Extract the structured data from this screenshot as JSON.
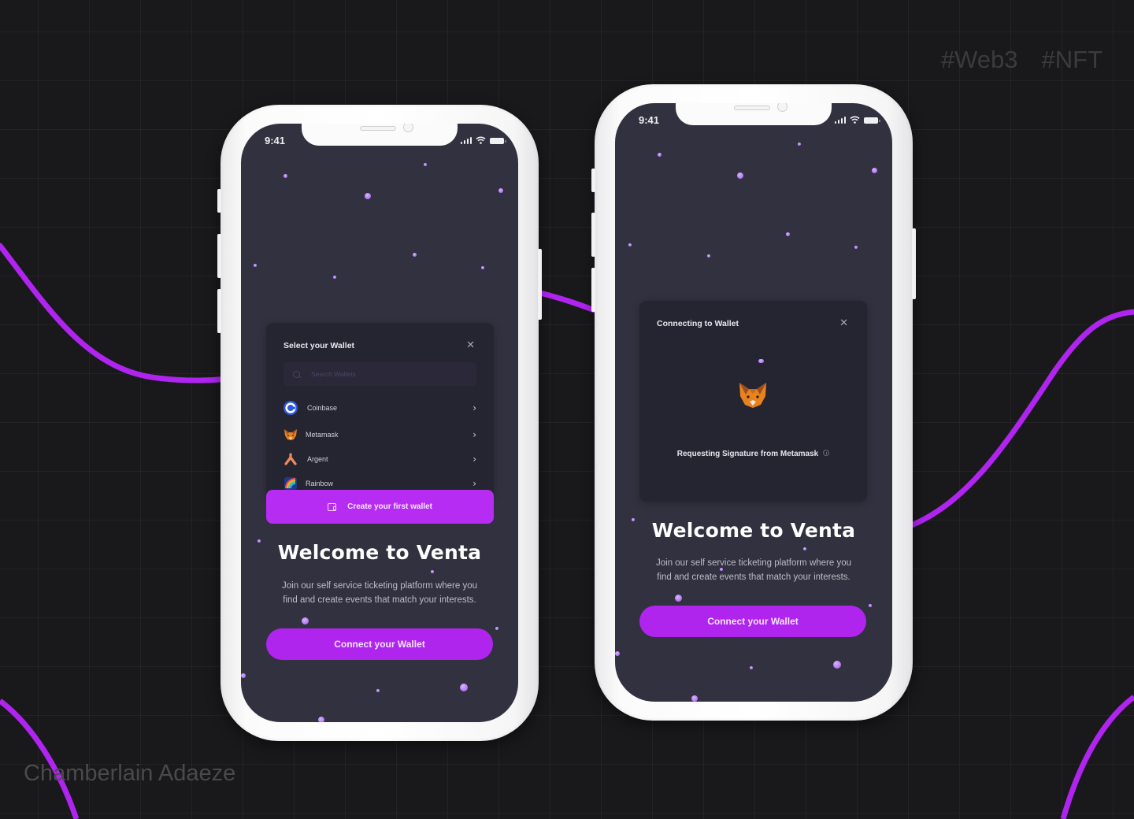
{
  "background": {
    "color": "#19181a",
    "accent_curve_color": "#b024f0",
    "tags": [
      "#Web3",
      "#NFT"
    ],
    "credit": "Chamberlain Adaeze"
  },
  "colors": {
    "primary": "#b025ee",
    "screen_bg": "#32313f",
    "modal_bg": "#252431"
  },
  "phone_left": {
    "status": {
      "time": "9:41",
      "icons": [
        "signal-icon",
        "wifi-icon",
        "battery-icon"
      ]
    },
    "modal": {
      "title": "Select your Wallet",
      "close_icon": "close-icon",
      "search": {
        "placeholder": "Search Wallets",
        "value": "",
        "icon": "search-icon"
      },
      "wallets": [
        {
          "name": "Coinbase",
          "icon": "coinbase-icon"
        },
        {
          "name": "Metamask",
          "icon": "metamask-fox-icon"
        },
        {
          "name": "Argent",
          "icon": "argent-icon"
        },
        {
          "name": "Rainbow",
          "icon": "rainbow-icon"
        }
      ],
      "create_button": {
        "label": "Create your first wallet",
        "icon": "wallet-icon"
      }
    },
    "welcome": {
      "title": "Welcome to Venta",
      "subtitle_line1": "Join our self service ticketing platform  where you",
      "subtitle_line2": "find and create events that match your interests."
    },
    "connect_button": {
      "label": "Connect your Wallet"
    }
  },
  "phone_right": {
    "status": {
      "time": "9:41",
      "icons": [
        "signal-icon",
        "wifi-icon",
        "battery-icon"
      ]
    },
    "modal": {
      "title": "Connecting to Wallet",
      "close_icon": "close-icon",
      "wallet_logo": "metamask-fox-icon",
      "request_text": "Requesting Signature from Metamask",
      "info_icon": "info-icon"
    },
    "welcome": {
      "title": "Welcome to Venta",
      "subtitle_line1": "Join our self service ticketing platform  where you",
      "subtitle_line2": "find and create events that match your interests."
    },
    "connect_button": {
      "label": "Connect your Wallet"
    }
  }
}
